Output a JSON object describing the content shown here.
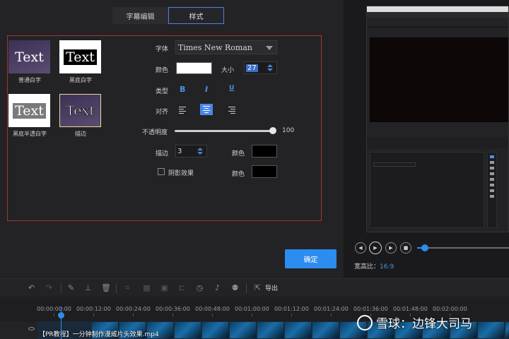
{
  "tabs": [
    {
      "label": "字幕编辑",
      "active": false
    },
    {
      "label": "样式",
      "active": true
    }
  ],
  "presets": [
    {
      "preview_text": "Text",
      "label": "普通白字"
    },
    {
      "preview_text": "Text",
      "label": "黑底白字"
    },
    {
      "preview_text": "Text",
      "label": "黑底半透白字"
    },
    {
      "preview_text": "Text",
      "label": "描边"
    }
  ],
  "form": {
    "font_label": "字体",
    "font_value": "Times New Roman",
    "color_label": "颜色",
    "color_value": "#ffffff",
    "size_label": "大小",
    "size_value": "27",
    "type_label": "类型",
    "bold": "B",
    "italic": "I",
    "underline": "U",
    "align_label": "对齐",
    "align_selected": "center",
    "opacity_label": "不透明度",
    "opacity_value": "100",
    "stroke_label": "描边",
    "stroke_value": "3",
    "stroke_color_label": "颜色",
    "stroke_color": "#000000",
    "shadow_label": "阴影效果",
    "shadow_checked": false,
    "shadow_color_label": "颜色",
    "shadow_color": "#000000"
  },
  "ok_button": "确定",
  "player": {
    "aspect_label": "宽高比：",
    "aspect_value": "16:9",
    "progress": 0.05
  },
  "toolbar": {
    "export_label": "导出"
  },
  "timeline": {
    "ticks": [
      "00:00:00:00",
      "00:00:12:00",
      "00:00:24:00",
      "00:00:36:00",
      "00:00:48:00",
      "00:01:00:00",
      "00:01:12:00",
      "00:01:24:00",
      "00:01:36:00",
      "00:01:48:00",
      "00:02:00:00"
    ],
    "clip_name": "【PR教程】一分钟制作漫威片头效果.mp4"
  },
  "watermark": "雪球：边锋大司马",
  "colors": {
    "accent": "#2d8cf0",
    "frame_border": "#a23535"
  }
}
